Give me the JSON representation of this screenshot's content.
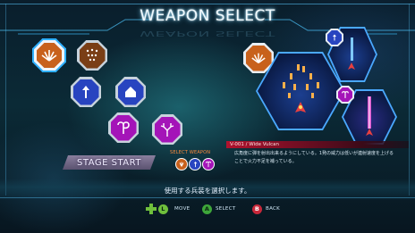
{
  "header": {
    "title": "WEAPON SELECT"
  },
  "weapon_grid": {
    "selected_index": 0,
    "slots": [
      {
        "icon": "wide-spread-icon",
        "color": "#c8611c"
      },
      {
        "icon": "scatter-dots-icon",
        "color": "#8a4a1c"
      },
      {
        "icon": "straight-shot-icon",
        "color": "#2a4cc8"
      },
      {
        "icon": "homing-missile-icon",
        "color": "#2a4cc8"
      },
      {
        "icon": "hook-laser-icon",
        "color": "#b016c0"
      },
      {
        "icon": "branch-lightning-icon",
        "color": "#b016c0"
      }
    ]
  },
  "stage_start": {
    "label": "STAGE START"
  },
  "selected_weapons": {
    "label": "SELECT WEAPON",
    "slots": [
      {
        "icon": "wide-spread-icon",
        "color": "#c8611c"
      },
      {
        "icon": "straight-shot-icon",
        "color": "#2a4cc8"
      },
      {
        "icon": "hook-laser-icon",
        "color": "#b016c0"
      }
    ]
  },
  "weapon_info": {
    "name": "V-001 / Wide Vulcan",
    "description_line1": "広角度に弾を射出出来るようにしている。1発の威力は低いが連射速度を上げる",
    "description_line2": "ことで火力不足を補っている。"
  },
  "footer": {
    "description": "使用する兵装を選択します。",
    "controls": [
      {
        "glyph": "L",
        "label": "MOVE",
        "color": "#6fbf3c"
      },
      {
        "glyph": "A",
        "label": "SELECT",
        "color": "#3ea63a"
      },
      {
        "glyph": "B",
        "label": "BACK",
        "color": "#c8283a"
      }
    ]
  }
}
